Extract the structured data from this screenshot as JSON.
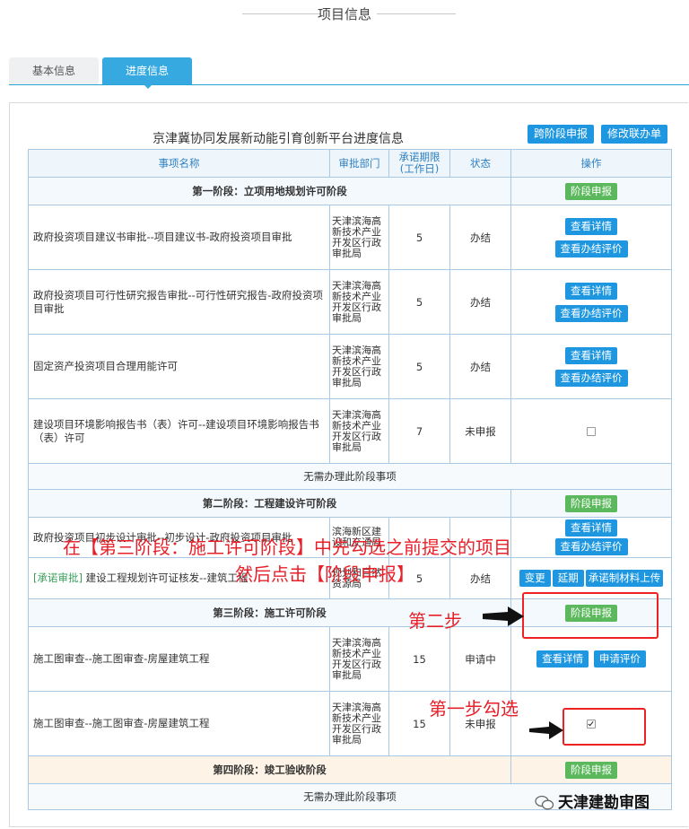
{
  "page": {
    "title": "项目信息"
  },
  "tabs": [
    {
      "label": "基本信息",
      "active": false
    },
    {
      "label": "进度信息",
      "active": true
    }
  ],
  "panel": {
    "title": "京津冀协同发展新动能引育创新平台进度信息",
    "btn_cross": "跨阶段申报",
    "btn_modify": "修改联办单"
  },
  "table": {
    "headers": {
      "name": "事项名称",
      "dept": "审批部门",
      "period": "承诺期限(工作日)",
      "status": "状态",
      "op": "操作"
    },
    "stage1": {
      "label": "第一阶段：立项用地规划许可阶段",
      "btn": "阶段申报"
    },
    "r1": {
      "name": "政府投资项目建议书审批--项目建议书-政府投资项目审批",
      "dept": "天津滨海高新技术产业开发区行政审批局",
      "period": "5",
      "status": "办结",
      "btn1": "查看详情",
      "btn2": "查看办结评价"
    },
    "r2": {
      "name": "政府投资项目可行性研究报告审批--可行性研究报告-政府投资项目审批",
      "dept": "天津滨海高新技术产业开发区行政审批局",
      "period": "5",
      "status": "办结",
      "btn1": "查看详情",
      "btn2": "查看办结评价"
    },
    "r3": {
      "name": "固定资产投资项目合理用能许可",
      "dept": "天津滨海高新技术产业开发区行政审批局",
      "period": "5",
      "status": "办结",
      "btn1": "查看详情",
      "btn2": "查看办结评价"
    },
    "r4": {
      "name": "建设项目环境影响报告书（表）许可--建设项目环境影响报告书（表）许可",
      "dept": "天津滨海高新技术产业开发区行政审批局",
      "period": "7",
      "status": "未申报"
    },
    "none1": "无需办理此阶段事项",
    "stage2": {
      "label": "第二阶段：工程建设许可阶段",
      "btn": "阶段申报"
    },
    "r5": {
      "name": "政府投资项目初步设计审批--初步设计-政府投资项目审批",
      "dept": "滨海新区建设和交通局",
      "period": "",
      "status": "",
      "btn1": "查看详情",
      "btn2": "查看办结评价"
    },
    "r6": {
      "tag": "[承诺审批]",
      "name": "建设工程规划许可证核发--建筑工程",
      "dept": "规划和自然资源局",
      "period": "5",
      "status": "办结",
      "btn1": "变更",
      "btn2": "延期",
      "btn3": "承诺制材料上传"
    },
    "stage3": {
      "label": "第三阶段：施工许可阶段",
      "btn": "阶段申报"
    },
    "r7": {
      "name": "施工图审查--施工图审查-房屋建筑工程",
      "dept": "天津滨海高新技术产业开发区行政审批局",
      "period": "15",
      "status": "申请中",
      "btn1": "查看详情",
      "btn2": "申请评价"
    },
    "r8": {
      "name": "施工图审查--施工图审查-房屋建筑工程",
      "dept": "天津滨海高新技术产业开发区行政审批局",
      "period": "15",
      "status": "未申报"
    },
    "stage4": {
      "label": "第四阶段：竣工验收阶段",
      "btn": "阶段申报"
    },
    "none2": "无需办理此阶段事项"
  },
  "annotations": {
    "line1": "在【第三阶段：施工许可阶段】中先勾选之前提交的项目",
    "line2": "然后点击【阶段申报】",
    "step2": "第二步",
    "step1": "第一步勾选"
  },
  "watermark": "天津建勘审图",
  "colors": {
    "accent": "#1e97e0",
    "green": "#5cb85c",
    "annotation": "#e8202a"
  }
}
